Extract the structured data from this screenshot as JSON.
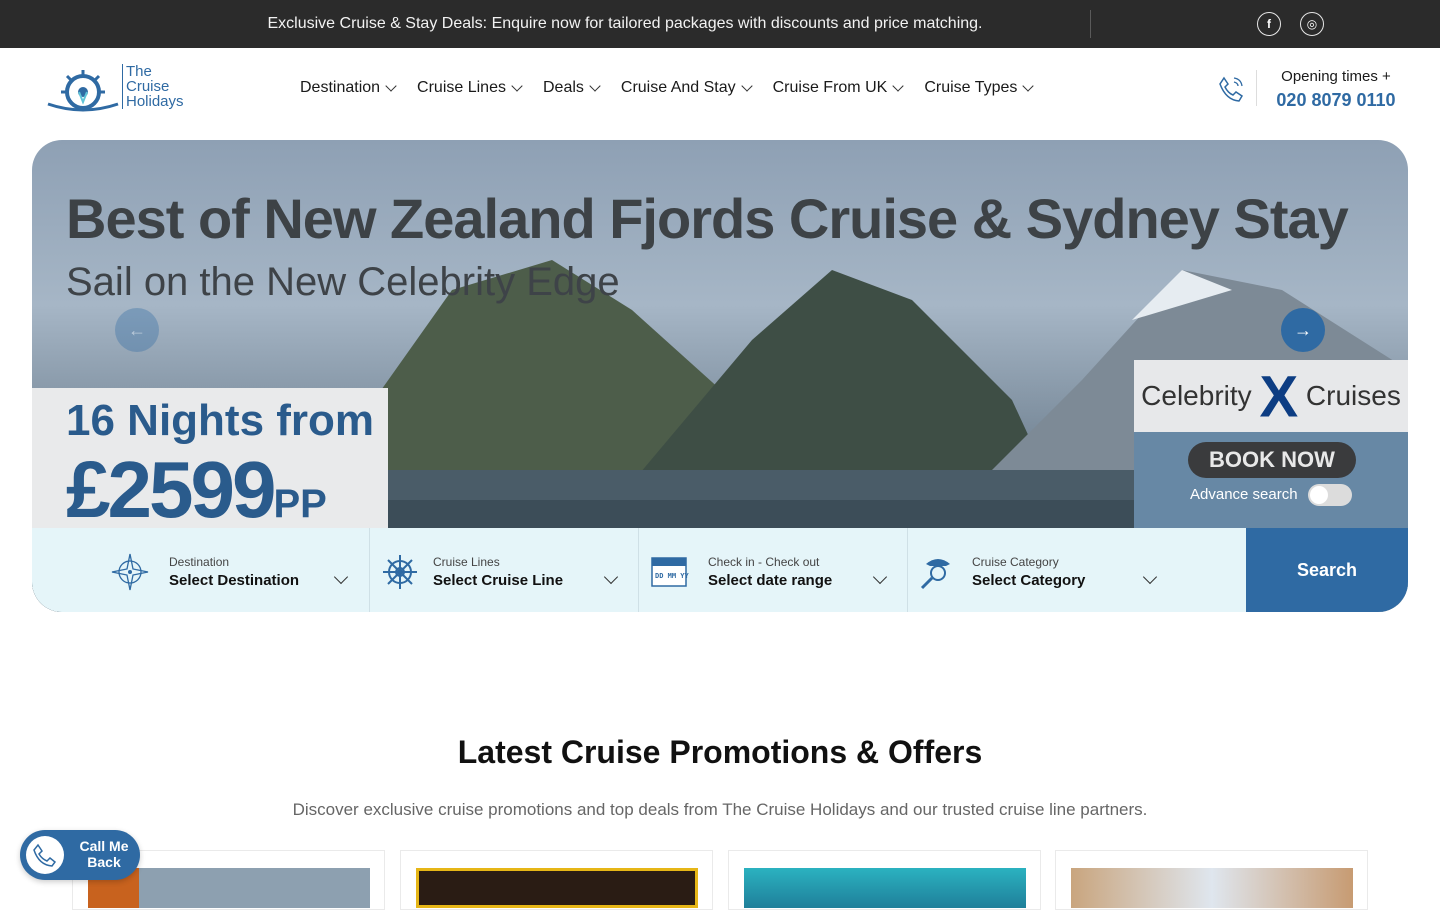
{
  "topbar": {
    "promo_text": "Exclusive Cruise & Stay Deals: Enquire now for tailored packages with discounts and price matching.",
    "social": [
      {
        "icon": "facebook-icon",
        "label": "f"
      },
      {
        "icon": "instagram-icon",
        "label": "◎"
      }
    ]
  },
  "header": {
    "logo_text": [
      "The",
      "Cruise",
      "Holidays"
    ],
    "nav": [
      "Destination",
      "Cruise Lines",
      "Deals",
      "Cruise And Stay",
      "Cruise From UK",
      "Cruise Types"
    ],
    "opening_times": "Opening times +",
    "phone": "020 8079 0110"
  },
  "hero": {
    "title": "Best of New Zealand Fjords Cruise & Sydney Stay",
    "subtitle": "Sail on the New Celebrity Edge",
    "nights": "16 Nights from",
    "price": "£2599",
    "price_suffix": "PP",
    "brand": "Celebrity",
    "brand_x": "X",
    "brand_suffix": "Cruises",
    "book_now": "BOOK NOW",
    "advance_search": "Advance search",
    "advance_search_on": false
  },
  "search": {
    "destination": {
      "label": "Destination",
      "value": "Select Destination"
    },
    "cruise_lines": {
      "label": "Cruise Lines",
      "value": "Select Cruise Line"
    },
    "dates": {
      "label": "Check in - Check out",
      "value": "Select date range"
    },
    "category": {
      "label": "Cruise Category",
      "value": "Select Category"
    },
    "button": "Search"
  },
  "promotions": {
    "title": "Latest Cruise Promotions & Offers",
    "description": "Discover exclusive cruise promotions and top deals from The Cruise Holidays and our trusted cruise line partners."
  },
  "callback": {
    "line1": "Call Me",
    "line2": "Back"
  },
  "colors": {
    "brand_blue": "#2f6aa3",
    "topbar": "#2b2b2b",
    "search_bg": "#e5f5f9"
  }
}
